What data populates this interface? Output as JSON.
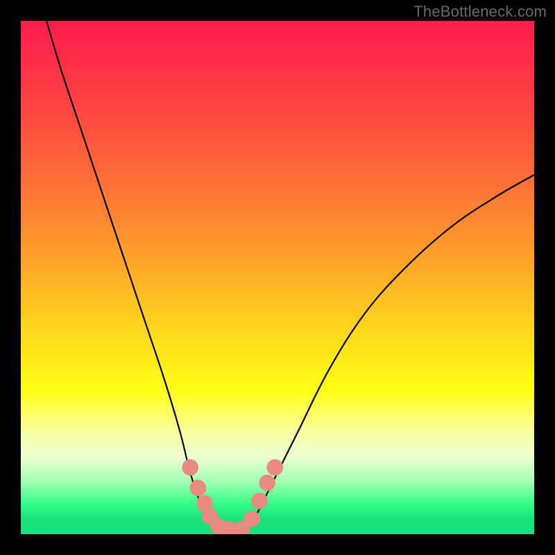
{
  "watermark": "TheBottleneck.com",
  "gradient_stops": [
    {
      "pct": 0,
      "color": "#ff1b4d"
    },
    {
      "pct": 18,
      "color": "#ff4741"
    },
    {
      "pct": 40,
      "color": "#ff8b2f"
    },
    {
      "pct": 58,
      "color": "#ffcf1f"
    },
    {
      "pct": 72,
      "color": "#ffff14"
    },
    {
      "pct": 80,
      "color": "#fbffa0"
    },
    {
      "pct": 85,
      "color": "#eaffd0"
    },
    {
      "pct": 90,
      "color": "#9dffb0"
    },
    {
      "pct": 94,
      "color": "#35ff88"
    },
    {
      "pct": 97,
      "color": "#18e27a"
    },
    {
      "pct": 100,
      "color": "#18e27a"
    }
  ],
  "chart_data": {
    "type": "line",
    "title": "",
    "xlabel": "",
    "ylabel": "",
    "xlim": [
      0,
      100
    ],
    "ylim": [
      0,
      100
    ],
    "series": [
      {
        "name": "left-curve",
        "x": [
          5,
          8,
          12,
          16,
          20,
          24,
          28,
          31,
          33,
          35,
          36.5,
          38
        ],
        "y": [
          100,
          90,
          78,
          66,
          54,
          42,
          30,
          20,
          12,
          6,
          3,
          1
        ]
      },
      {
        "name": "right-curve",
        "x": [
          44,
          46,
          49,
          54,
          60,
          67,
          75,
          84,
          93,
          100
        ],
        "y": [
          1,
          4,
          10,
          20,
          32,
          43,
          52,
          60,
          66,
          70
        ]
      },
      {
        "name": "valley-floor",
        "x": [
          38,
          44
        ],
        "y": [
          1,
          1
        ]
      }
    ],
    "markers": {
      "name": "salmon-dots",
      "color": "#e88a80",
      "radius_pct": 1.6,
      "points": [
        {
          "x": 33.0,
          "y": 13.0
        },
        {
          "x": 34.5,
          "y": 9.0
        },
        {
          "x": 35.8,
          "y": 6.0
        },
        {
          "x": 36.8,
          "y": 3.5
        },
        {
          "x": 38.5,
          "y": 1.5
        },
        {
          "x": 40.5,
          "y": 1.0
        },
        {
          "x": 43.0,
          "y": 1.0
        },
        {
          "x": 45.0,
          "y": 3.0
        },
        {
          "x": 46.5,
          "y": 6.5
        },
        {
          "x": 48.0,
          "y": 10.0
        },
        {
          "x": 49.5,
          "y": 13.0
        }
      ]
    }
  }
}
